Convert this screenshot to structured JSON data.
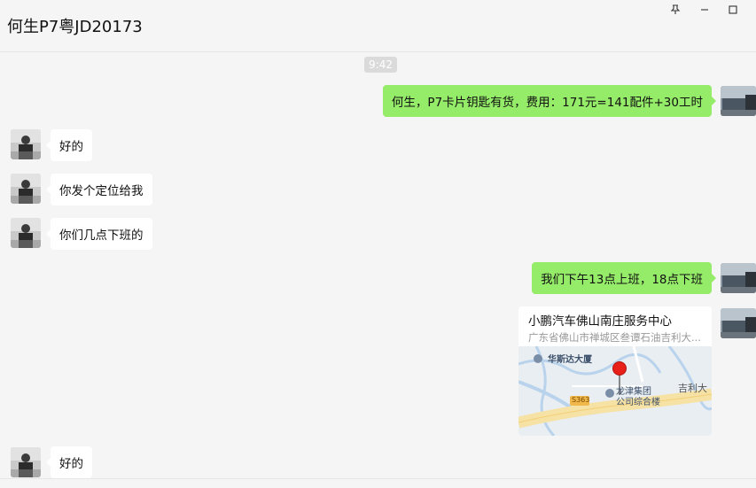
{
  "header": {
    "title": "何生P7粤JD20173",
    "pin_icon": "pin-icon",
    "minimize_icon": "minimize-icon",
    "maximize_icon": "maximize-icon"
  },
  "chat": {
    "time_separator": "9:42",
    "messages": [
      {
        "side": "right",
        "type": "text",
        "text": "何生，P7卡片钥匙有货，费用：171元=141配件+30工时"
      },
      {
        "side": "left",
        "type": "text",
        "text": "好的"
      },
      {
        "side": "left",
        "type": "text",
        "text": "你发个定位给我"
      },
      {
        "side": "left",
        "type": "text",
        "text": "你们几点下班的"
      },
      {
        "side": "right",
        "type": "text",
        "text": "我们下午13点上班，18点下班"
      },
      {
        "side": "right",
        "type": "location",
        "name": "小鹏汽车佛山南庄服务中心",
        "address": "广东省佛山市禅城区叁谭石油吉利大...",
        "map": {
          "poi_1": "华斯达大厦",
          "poi_2_line1": "龙津集团",
          "poi_2_line2": "公司综合楼",
          "road_label": "吉利大",
          "road_badge": "S363"
        }
      },
      {
        "side": "left",
        "type": "text",
        "text": "好的"
      }
    ]
  },
  "colors": {
    "background": "#f5f5f5",
    "outgoing_bubble": "#95ec69",
    "incoming_bubble": "#ffffff",
    "marker": "#e8201a"
  }
}
